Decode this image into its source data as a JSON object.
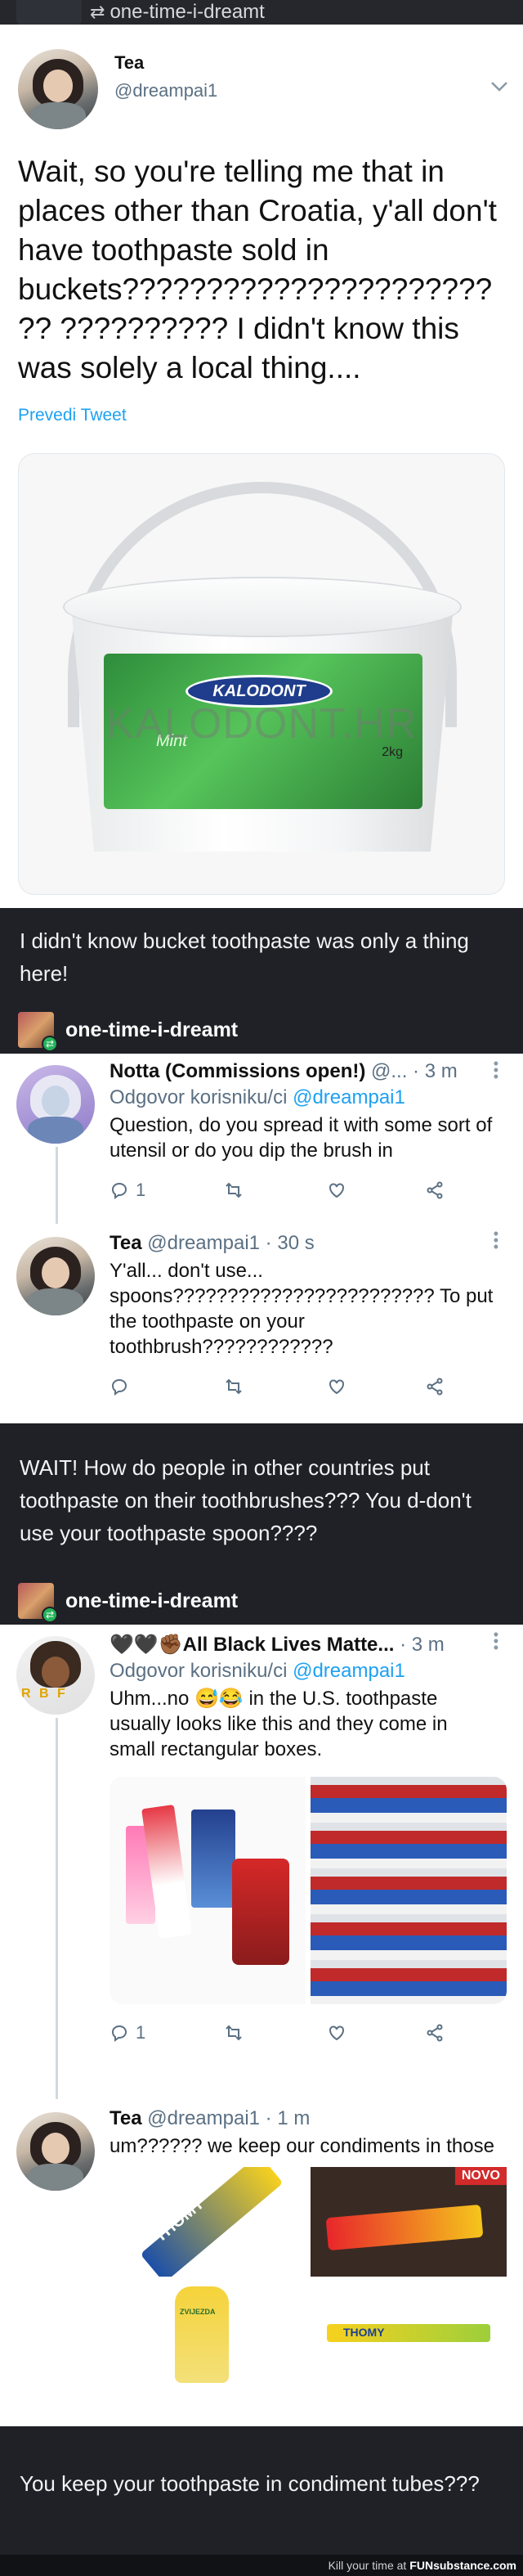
{
  "top_bar": {
    "reblog_name": "one-time-i-dreamt"
  },
  "tweet1": {
    "name": "Tea",
    "handle": "@dreampai1",
    "text": "Wait, so you're telling me that in places other than Croatia, y'all don't have toothpaste sold in buckets???????????????????????? ?????????? I didn't know this was solely a local thing....",
    "translate": "Prevedi Tweet",
    "image": {
      "brand": "KALODONT",
      "label_sub": "Mint",
      "label_weight": "2kg",
      "watermark": "KALODONT.HR"
    }
  },
  "caption1": "I didn't know bucket toothpaste was only a thing here!",
  "reblog1": {
    "name": "one-time-i-dreamt"
  },
  "tweet2": {
    "name": "Notta (Commissions open!)",
    "handle_time": "@... · 3 m",
    "reply_prefix": "Odgovor korisniku/ci",
    "reply_to": "@dreampai1",
    "text": "Question, do you spread it with some sort of utensil or do you dip the brush in",
    "replies": "1"
  },
  "tweet3": {
    "name": "Tea",
    "handle_time": "@dreampai1 · 30 s",
    "text": "Y'all... don't use... spoons???????????????????????? To put the toothpaste on your toothbrush????????????"
  },
  "caption2": "WAIT! How do people in other countries put toothpaste on their toothbrushes??? You d-don't use your toothpaste spoon????",
  "reblog2": {
    "name": "one-time-i-dreamt"
  },
  "tweet4": {
    "name": "🖤🖤✊🏾All Black Lives Matte...",
    "handle_time": "· 3 m",
    "reply_prefix": "Odgovor korisniku/ci",
    "reply_to": "@dreampai1",
    "text": "Uhm...no 😅😂 in the U.S. toothpaste usually looks like this and they come in small rectangular boxes.",
    "replies": "1",
    "avatar_letters": "R B F"
  },
  "tweet5": {
    "name": "Tea",
    "handle_time": "@dreampai1 · 1 m",
    "text": "um?????? we keep our condiments in those",
    "img_labels": [
      "THOMY",
      "NOVO",
      "ZVIJEZDA",
      "THOMY"
    ]
  },
  "caption3": "You keep your toothpaste in condiment tubes???",
  "footer": {
    "text": "Kill your time at",
    "brand": "FUNsubstance.com"
  },
  "colors": {
    "tumblr_bg": "#1f2127",
    "twitter_blue": "#1da1f2",
    "muted": "#5b7083",
    "reblog_green": "#24b35a"
  }
}
